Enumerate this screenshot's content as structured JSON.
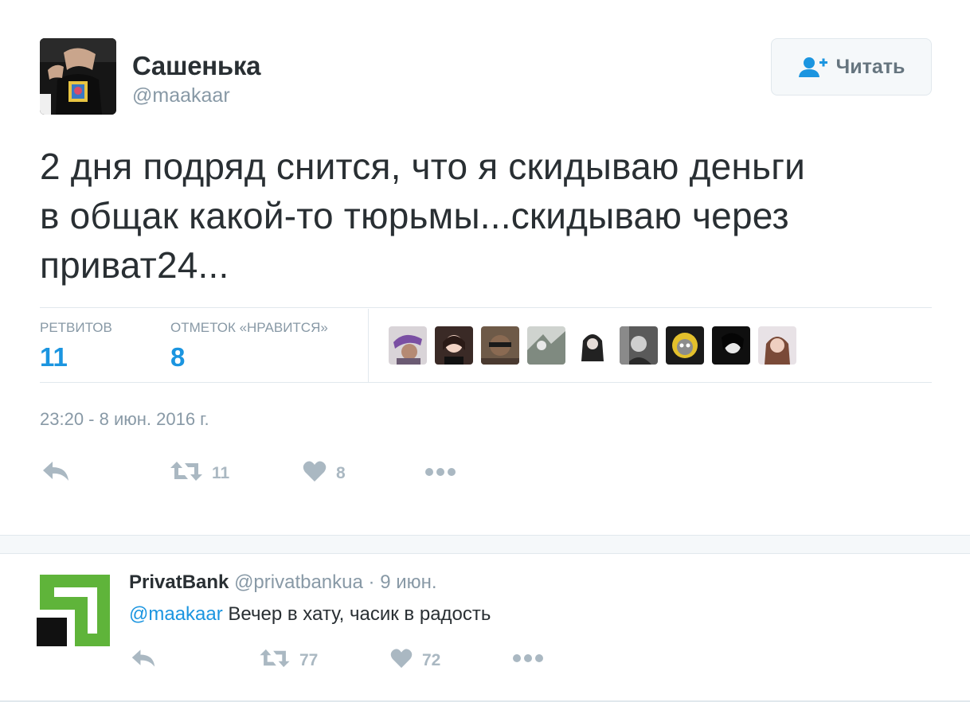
{
  "tweet": {
    "author_name": "Сашенька",
    "author_handle": "@maakaar",
    "follow_label": "Читать",
    "text_lines": [
      "2 дня подряд снится, что я скидываю деньги",
      "в общак какой-то тюрьмы...скидываю через",
      "приват24..."
    ],
    "stats": {
      "retweets_label": "РЕТВИТОВ",
      "retweets_value": "11",
      "likes_label": "ОТМЕТОК «НРАВИТСЯ»",
      "likes_value": "8"
    },
    "likers_count_shown": 9,
    "timestamp": "23:20 - 8 июн. 2016 г.",
    "actions": {
      "retweet_count": "11",
      "like_count": "8"
    }
  },
  "reply": {
    "author_name": "PrivatBank",
    "author_handle": "@privatbankua",
    "separator": " · ",
    "date": "9 июн.",
    "mention": "@maakaar",
    "text": " Вечер в хату, часик в радость",
    "actions": {
      "retweet_count": "77",
      "like_count": "72"
    }
  },
  "colors": {
    "accent_blue": "#1b95e0",
    "muted_gray": "#8899a6",
    "icon_gray": "#aab8c2",
    "privatbank_green": "#5fb43a"
  },
  "icons": [
    "follow-person-plus-icon",
    "reply-icon",
    "retweet-icon",
    "heart-icon",
    "more-dots-icon"
  ]
}
